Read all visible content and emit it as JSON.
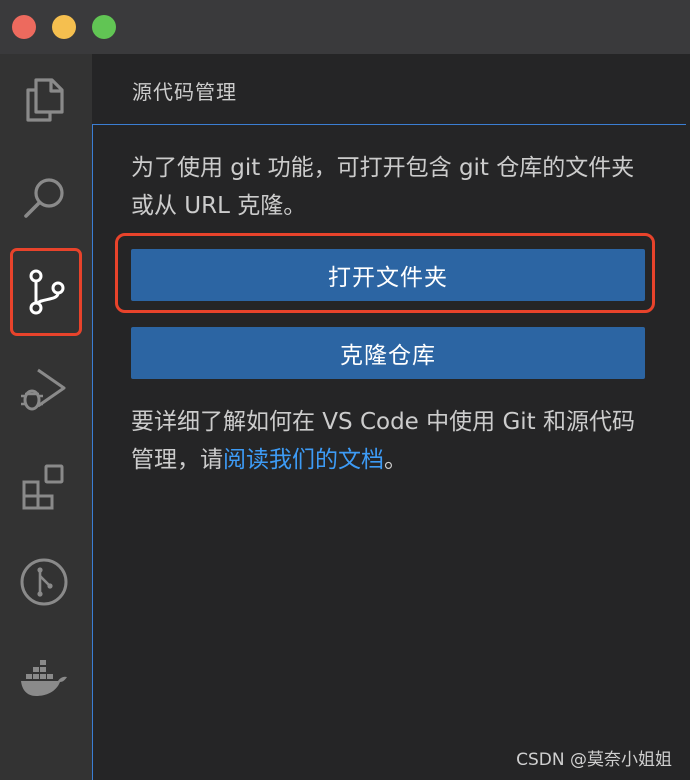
{
  "sidebar": {
    "title": "源代码管理",
    "description": "为了使用 git 功能，可打开包含 git 仓库的文件夹或从 URL 克隆。",
    "open_folder_label": "打开文件夹",
    "clone_repo_label": "克隆仓库",
    "help_prefix": "要详细了解如何在 VS Code 中使用 Git 和源代码管理，请",
    "help_link": "阅读我们的文档",
    "help_suffix": "。"
  },
  "activity_bar": {
    "items": [
      {
        "icon": "explorer-icon"
      },
      {
        "icon": "search-icon"
      },
      {
        "icon": "source-control-icon"
      },
      {
        "icon": "run-debug-icon"
      },
      {
        "icon": "extensions-icon"
      },
      {
        "icon": "git-graph-icon"
      },
      {
        "icon": "docker-icon"
      }
    ]
  },
  "watermark": "CSDN @莫奈小姐姐",
  "colors": {
    "accent_button": "#2c65a3",
    "highlight_box": "#e8432b",
    "link": "#3d9bf5",
    "panel_border": "#3b7ed3"
  }
}
